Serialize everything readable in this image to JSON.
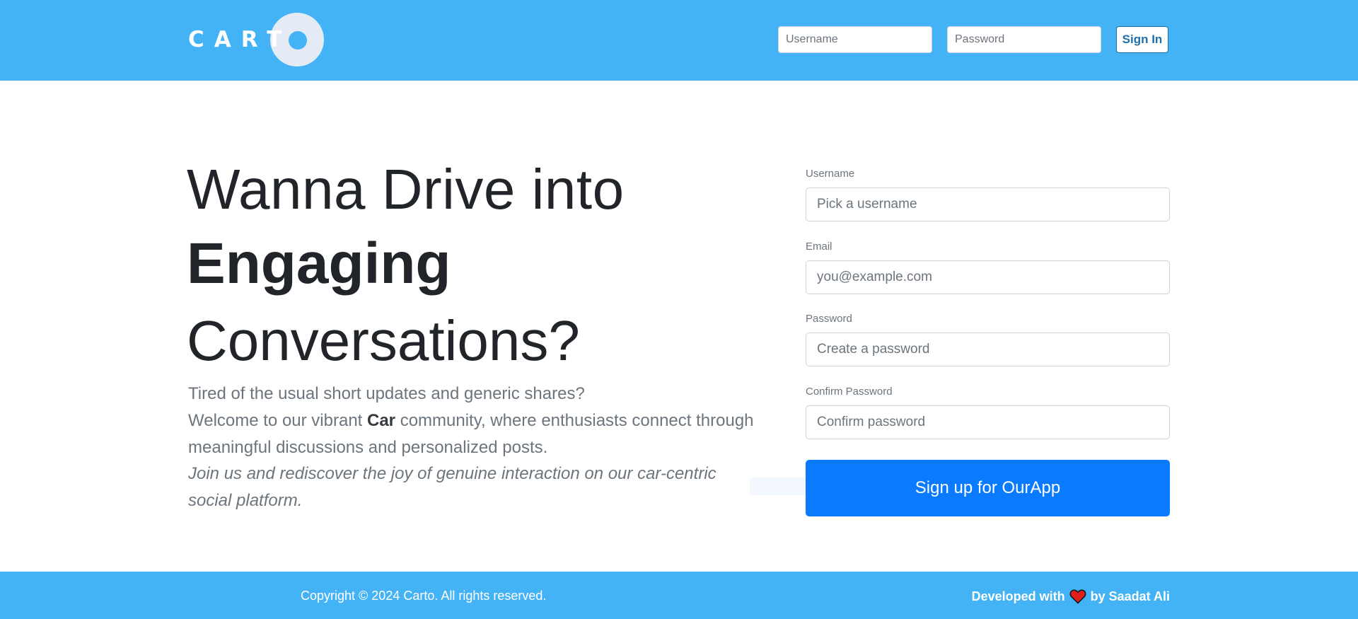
{
  "header": {
    "logo_text": "CART",
    "username_placeholder": "Username",
    "password_placeholder": "Password",
    "signin_label": "Sign In"
  },
  "hero": {
    "line1": "Wanna Drive into",
    "line2": "Engaging",
    "line3": "Conversations?",
    "para1": "Tired of the usual short updates and generic shares?",
    "para2_before": "Welcome to our vibrant ",
    "para2_bold": "Car",
    "para2_after": " community, where enthusiasts connect through meaningful discussions and personalized posts.",
    "para3": "Join us and rediscover the joy of genuine interaction on our car-centric social platform."
  },
  "form": {
    "username_label": "Username",
    "username_placeholder": "Pick a username",
    "email_label": "Email",
    "email_placeholder": "you@example.com",
    "password_label": "Password",
    "password_placeholder": "Create a password",
    "confirm_label": "Confirm Password",
    "confirm_placeholder": "Confirm password",
    "submit_label": "Sign up for OurApp"
  },
  "footer": {
    "copyright": "Copyright © 2024 Carto. All rights reserved.",
    "developed_with": "Developed with",
    "by_author": "by Saadat Ali",
    "heart_icon": "heart-icon"
  },
  "colors": {
    "brand_blue": "#44b3f5",
    "primary_button": "#0a7bff",
    "heart": "#e0201c"
  }
}
